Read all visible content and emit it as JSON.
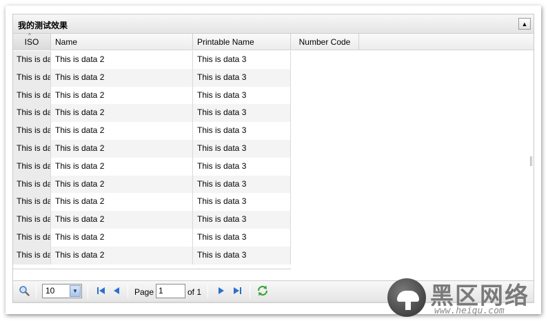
{
  "panel": {
    "title": "我的测试效果"
  },
  "columns": [
    "ISO",
    "Name",
    "Printable Name",
    "Number Code"
  ],
  "rows": [
    [
      "This is da",
      "This is data 2",
      "This is data 3"
    ],
    [
      "This is da",
      "This is data 2",
      "This is data 3"
    ],
    [
      "This is da",
      "This is data 2",
      "This is data 3"
    ],
    [
      "This is da",
      "This is data 2",
      "This is data 3"
    ],
    [
      "This is da",
      "This is data 2",
      "This is data 3"
    ],
    [
      "This is da",
      "This is data 2",
      "This is data 3"
    ],
    [
      "This is da",
      "This is data 2",
      "This is data 3"
    ],
    [
      "This is da",
      "This is data 2",
      "This is data 3"
    ],
    [
      "This is da",
      "This is data 2",
      "This is data 3"
    ],
    [
      "This is da",
      "This is data 2",
      "This is data 3"
    ],
    [
      "This is da",
      "This is data 2",
      "This is data 3"
    ],
    [
      "This is da",
      "This is data 2",
      "This is data 3"
    ]
  ],
  "pager": {
    "page_size": "10",
    "page_label": "Page",
    "current_page": "1",
    "of_label": "of 1"
  },
  "icons": {
    "search": "search-icon",
    "first": "first-page-icon",
    "prev": "prev-page-icon",
    "next": "next-page-icon",
    "last": "last-page-icon",
    "refresh": "refresh-icon",
    "collapse": "collapse-icon",
    "sort": "sort-asc-icon"
  },
  "watermark": {
    "title": "黑区网络",
    "url": "www.heiqu.com"
  }
}
